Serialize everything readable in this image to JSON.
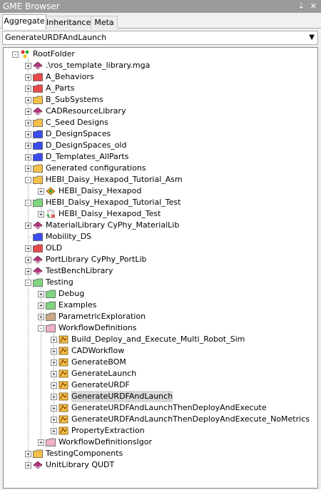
{
  "window": {
    "title": "GME Browser",
    "pin_glyph": "⇣",
    "close_glyph": "✕"
  },
  "tabs": [
    {
      "label": "Aggregate",
      "active": true
    },
    {
      "label": "Inheritance",
      "active": false
    },
    {
      "label": "Meta",
      "active": false
    }
  ],
  "combo": {
    "value": "GenerateURDFAndLaunch",
    "chevron": "⌵"
  },
  "colors": {
    "folder_yellow": "#f5c04a",
    "folder_red": "#e84a4a",
    "folder_blue": "#3a4cf0",
    "folder_green": "#7fd67f",
    "folder_pink": "#f0b0c8",
    "folder_tan": "#c9a985",
    "library_purple": "#b0357a",
    "model_orange": "#f5a623",
    "selected_bg": "#d9d9d9"
  },
  "tree": [
    {
      "id": "root",
      "depth": 0,
      "label": "RootFolder",
      "icon": "root-folder-icon",
      "toggle": "-"
    },
    {
      "id": "r1",
      "depth": 1,
      "label": ".\\ros_template_library.mga",
      "icon": "library-icon",
      "toggle": "+"
    },
    {
      "id": "r2",
      "depth": 1,
      "label": "A_Behaviors",
      "icon": "red-folder-icon",
      "toggle": "+"
    },
    {
      "id": "r3",
      "depth": 1,
      "label": "A_Parts",
      "icon": "red-folder-icon",
      "toggle": "+"
    },
    {
      "id": "r4",
      "depth": 1,
      "label": "B_SubSystems",
      "icon": "yellow-folder-icon",
      "toggle": "+"
    },
    {
      "id": "r5",
      "depth": 1,
      "label": "CADResourceLibrary",
      "icon": "library-icon",
      "toggle": "+"
    },
    {
      "id": "r6",
      "depth": 1,
      "label": "C_Seed Designs",
      "icon": "yellow-folder-icon",
      "toggle": "+"
    },
    {
      "id": "r7",
      "depth": 1,
      "label": "D_DesignSpaces",
      "icon": "blue-folder-icon",
      "toggle": "+"
    },
    {
      "id": "r8",
      "depth": 1,
      "label": "D_DesignSpaces_old",
      "icon": "blue-folder-icon",
      "toggle": "+"
    },
    {
      "id": "r9",
      "depth": 1,
      "label": "D_Templates_AllParts",
      "icon": "blue-folder-icon",
      "toggle": "+"
    },
    {
      "id": "r10",
      "depth": 1,
      "label": "Generated configurations",
      "icon": "yellow-folder-icon",
      "toggle": "+"
    },
    {
      "id": "r11",
      "depth": 1,
      "label": "HEBI_Daisy_Hexapod_Tutorial_Asm",
      "icon": "yellow-folder-icon",
      "toggle": "-"
    },
    {
      "id": "r12",
      "depth": 2,
      "label": "HEBI_Daisy_Hexapod",
      "icon": "model-icon",
      "toggle": "+"
    },
    {
      "id": "r13",
      "depth": 1,
      "label": "HEBI_Daisy_Hexapod_Tutorial_Test",
      "icon": "green-folder-icon",
      "toggle": "-"
    },
    {
      "id": "r14",
      "depth": 2,
      "label": "HEBI_Daisy_Hexapod_Test",
      "icon": "test-bench-icon",
      "toggle": "+"
    },
    {
      "id": "r15",
      "depth": 1,
      "label": "MaterialLibrary CyPhy_MaterialLib",
      "icon": "library-icon",
      "toggle": "+"
    },
    {
      "id": "r16",
      "depth": 1,
      "label": "Mobility_DS",
      "icon": "blue-folder-icon",
      "toggle": ""
    },
    {
      "id": "r17",
      "depth": 1,
      "label": "OLD",
      "icon": "red-folder-icon",
      "toggle": "+"
    },
    {
      "id": "r18",
      "depth": 1,
      "label": "PortLibrary CyPhy_PortLib",
      "icon": "library-icon",
      "toggle": "+"
    },
    {
      "id": "r19",
      "depth": 1,
      "label": "TestBenchLibrary",
      "icon": "library-icon",
      "toggle": "+"
    },
    {
      "id": "r20",
      "depth": 1,
      "label": "Testing",
      "icon": "green-folder-icon",
      "toggle": "-"
    },
    {
      "id": "r21",
      "depth": 2,
      "label": "Debug",
      "icon": "green-folder-icon",
      "toggle": "+"
    },
    {
      "id": "r22",
      "depth": 2,
      "label": "Examples",
      "icon": "green-folder-icon",
      "toggle": "+"
    },
    {
      "id": "r23",
      "depth": 2,
      "label": "ParametricExploration",
      "icon": "tan-folder-icon",
      "toggle": "+"
    },
    {
      "id": "r24",
      "depth": 2,
      "label": "WorkflowDefinitions",
      "icon": "pink-folder-icon",
      "toggle": "-"
    },
    {
      "id": "r25",
      "depth": 3,
      "label": "Build_Deploy_and_Execute_Multi_Robot_Sim",
      "icon": "workflow-icon",
      "toggle": "+"
    },
    {
      "id": "r26",
      "depth": 3,
      "label": "CADWorkflow",
      "icon": "workflow-icon",
      "toggle": "+"
    },
    {
      "id": "r27",
      "depth": 3,
      "label": "GenerateBOM",
      "icon": "workflow-icon",
      "toggle": "+"
    },
    {
      "id": "r28",
      "depth": 3,
      "label": "GenerateLaunch",
      "icon": "workflow-icon",
      "toggle": "+"
    },
    {
      "id": "r29",
      "depth": 3,
      "label": "GenerateURDF",
      "icon": "workflow-icon",
      "toggle": "+"
    },
    {
      "id": "r30",
      "depth": 3,
      "label": "GenerateURDFAndLaunch",
      "icon": "workflow-icon",
      "toggle": "+",
      "selected": true
    },
    {
      "id": "r31",
      "depth": 3,
      "label": "GenerateURDFAndLaunchThenDeployAndExecute",
      "icon": "workflow-icon",
      "toggle": "+"
    },
    {
      "id": "r32",
      "depth": 3,
      "label": "GenerateURDFAndLaunchThenDeployAndExecute_NoMetrics",
      "icon": "workflow-icon",
      "toggle": "+"
    },
    {
      "id": "r33",
      "depth": 3,
      "label": "PropertyExtraction",
      "icon": "workflow-icon",
      "toggle": "+"
    },
    {
      "id": "r34",
      "depth": 2,
      "label": "WorkflowDefinitionsIgor",
      "icon": "pink-folder-icon",
      "toggle": "+"
    },
    {
      "id": "r35",
      "depth": 1,
      "label": "TestingComponents",
      "icon": "yellow-folder-icon",
      "toggle": "+"
    },
    {
      "id": "r36",
      "depth": 1,
      "label": "UnitLibrary QUDT",
      "icon": "library-icon",
      "toggle": "+"
    }
  ]
}
